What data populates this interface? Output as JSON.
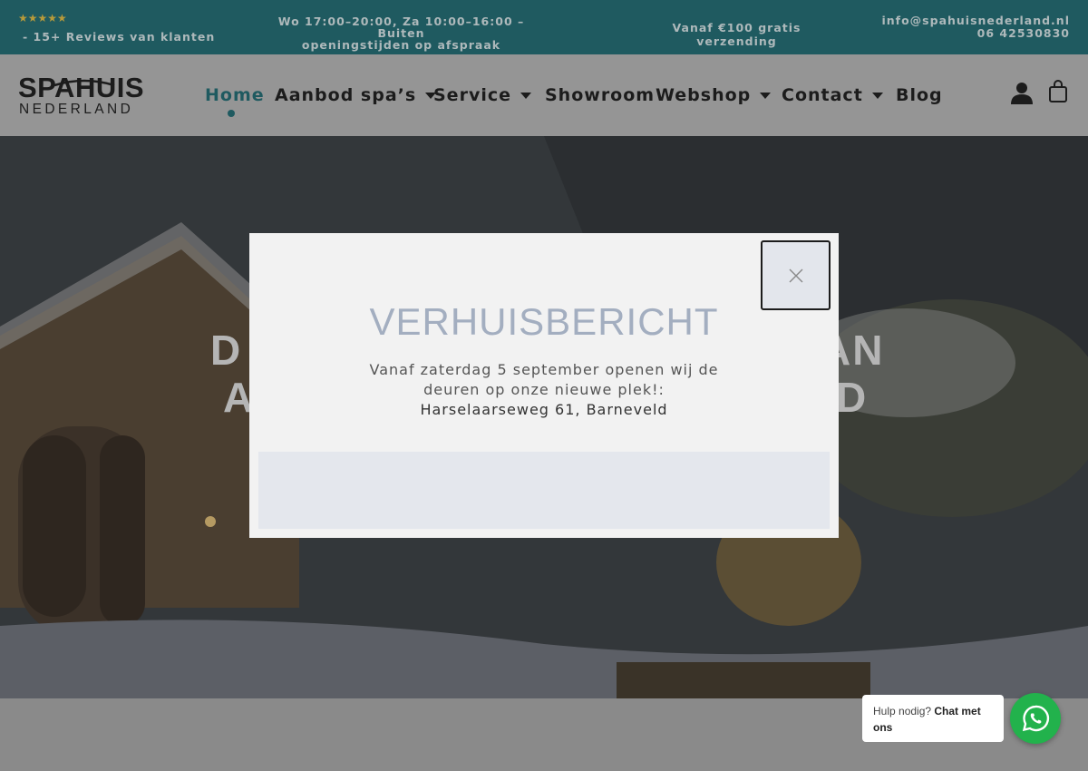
{
  "topbar": {
    "stars": "★★★★★",
    "reviews": "- 15+ Reviews van klanten",
    "hours_line1": "Wo 17:00–20:00, Za 10:00–16:00 – Buiten",
    "hours_line2": "openingstijden op afspraak",
    "shipping": "Vanaf €100 gratis verzending",
    "email": "info@spahuisnederland.nl",
    "phone": "06 42530830"
  },
  "header": {
    "logo_top": "SPAHUIS",
    "logo_bottom": "NEDERLAND",
    "nav": [
      {
        "label": "Home",
        "active": true,
        "dropdown": false
      },
      {
        "label": "Aanbod spa’s",
        "active": false,
        "dropdown": true
      },
      {
        "label": "Service",
        "active": false,
        "dropdown": true
      },
      {
        "label": "Showroom",
        "active": false,
        "dropdown": false
      },
      {
        "label": "Webshop",
        "active": false,
        "dropdown": true
      },
      {
        "label": "Contact",
        "active": false,
        "dropdown": true
      },
      {
        "label": "Blog",
        "active": false,
        "dropdown": false
      }
    ],
    "icons": [
      "user-icon",
      "cart-icon"
    ]
  },
  "hero": {
    "line1_left": "D",
    "line1_right": "AN",
    "line2_left": "A",
    "line2_right": "D"
  },
  "modal": {
    "title": "VERHUISBERICHT",
    "body_line1": "Vanaf zaterdag 5 september openen wij de",
    "body_line2": "deuren op onze nieuwe plek!:",
    "address": "Harselaarseweg 61, Barneveld",
    "close_icon": "close-icon"
  },
  "chat": {
    "text_prefix": "Hulp nodig? ",
    "text_bold": "Chat met ons",
    "icon": "whatsapp-icon"
  },
  "colors": {
    "topbar_bg": "#1f5a60",
    "accent": "#1f5a60",
    "modal_title": "#a3aec0",
    "whatsapp": "#22b24c"
  }
}
